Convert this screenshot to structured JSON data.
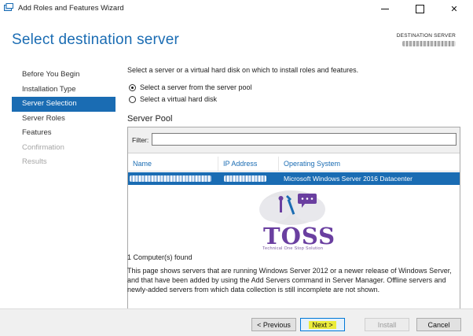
{
  "window": {
    "title": "Add Roles and Features Wizard",
    "min_glyph": "",
    "close_glyph": "✕"
  },
  "page": {
    "heading": "Select destination server",
    "destination_label": "DESTINATION SERVER"
  },
  "nav": {
    "items": [
      {
        "label": "Before You Begin",
        "state": "normal"
      },
      {
        "label": "Installation Type",
        "state": "normal"
      },
      {
        "label": "Server Selection",
        "state": "active"
      },
      {
        "label": "Server Roles",
        "state": "normal"
      },
      {
        "label": "Features",
        "state": "normal"
      },
      {
        "label": "Confirmation",
        "state": "disabled"
      },
      {
        "label": "Results",
        "state": "disabled"
      }
    ]
  },
  "main": {
    "intro": "Select a server or a virtual hard disk on which to install roles and features.",
    "radio_pool": "Select a server from the server pool",
    "radio_vhd": "Select a virtual hard disk",
    "selected_option": "pool",
    "pool_title": "Server Pool",
    "filter_label": "Filter:",
    "filter_value": "",
    "columns": [
      "Name",
      "IP Address",
      "Operating System"
    ],
    "rows": [
      {
        "os": "Microsoft Windows Server 2016 Datacenter",
        "selected": true
      }
    ],
    "found": "1 Computer(s) found",
    "description": "This page shows servers that are running Windows Server 2012 or a newer release of Windows Server, and that have been added by using the Add Servers command in Server Manager. Offline servers and newly-added servers from which data collection is still incomplete are not shown."
  },
  "watermark": {
    "word": "TOSS",
    "tagline": "Technical One Stop Solution"
  },
  "footer": {
    "prev": "< Previous",
    "next": "Next >",
    "install": "Install",
    "cancel": "Cancel"
  },
  "colors": {
    "accent": "#1a6cb3",
    "highlight": "#ecec3a",
    "watermark_purple": "#6a3fa0"
  }
}
